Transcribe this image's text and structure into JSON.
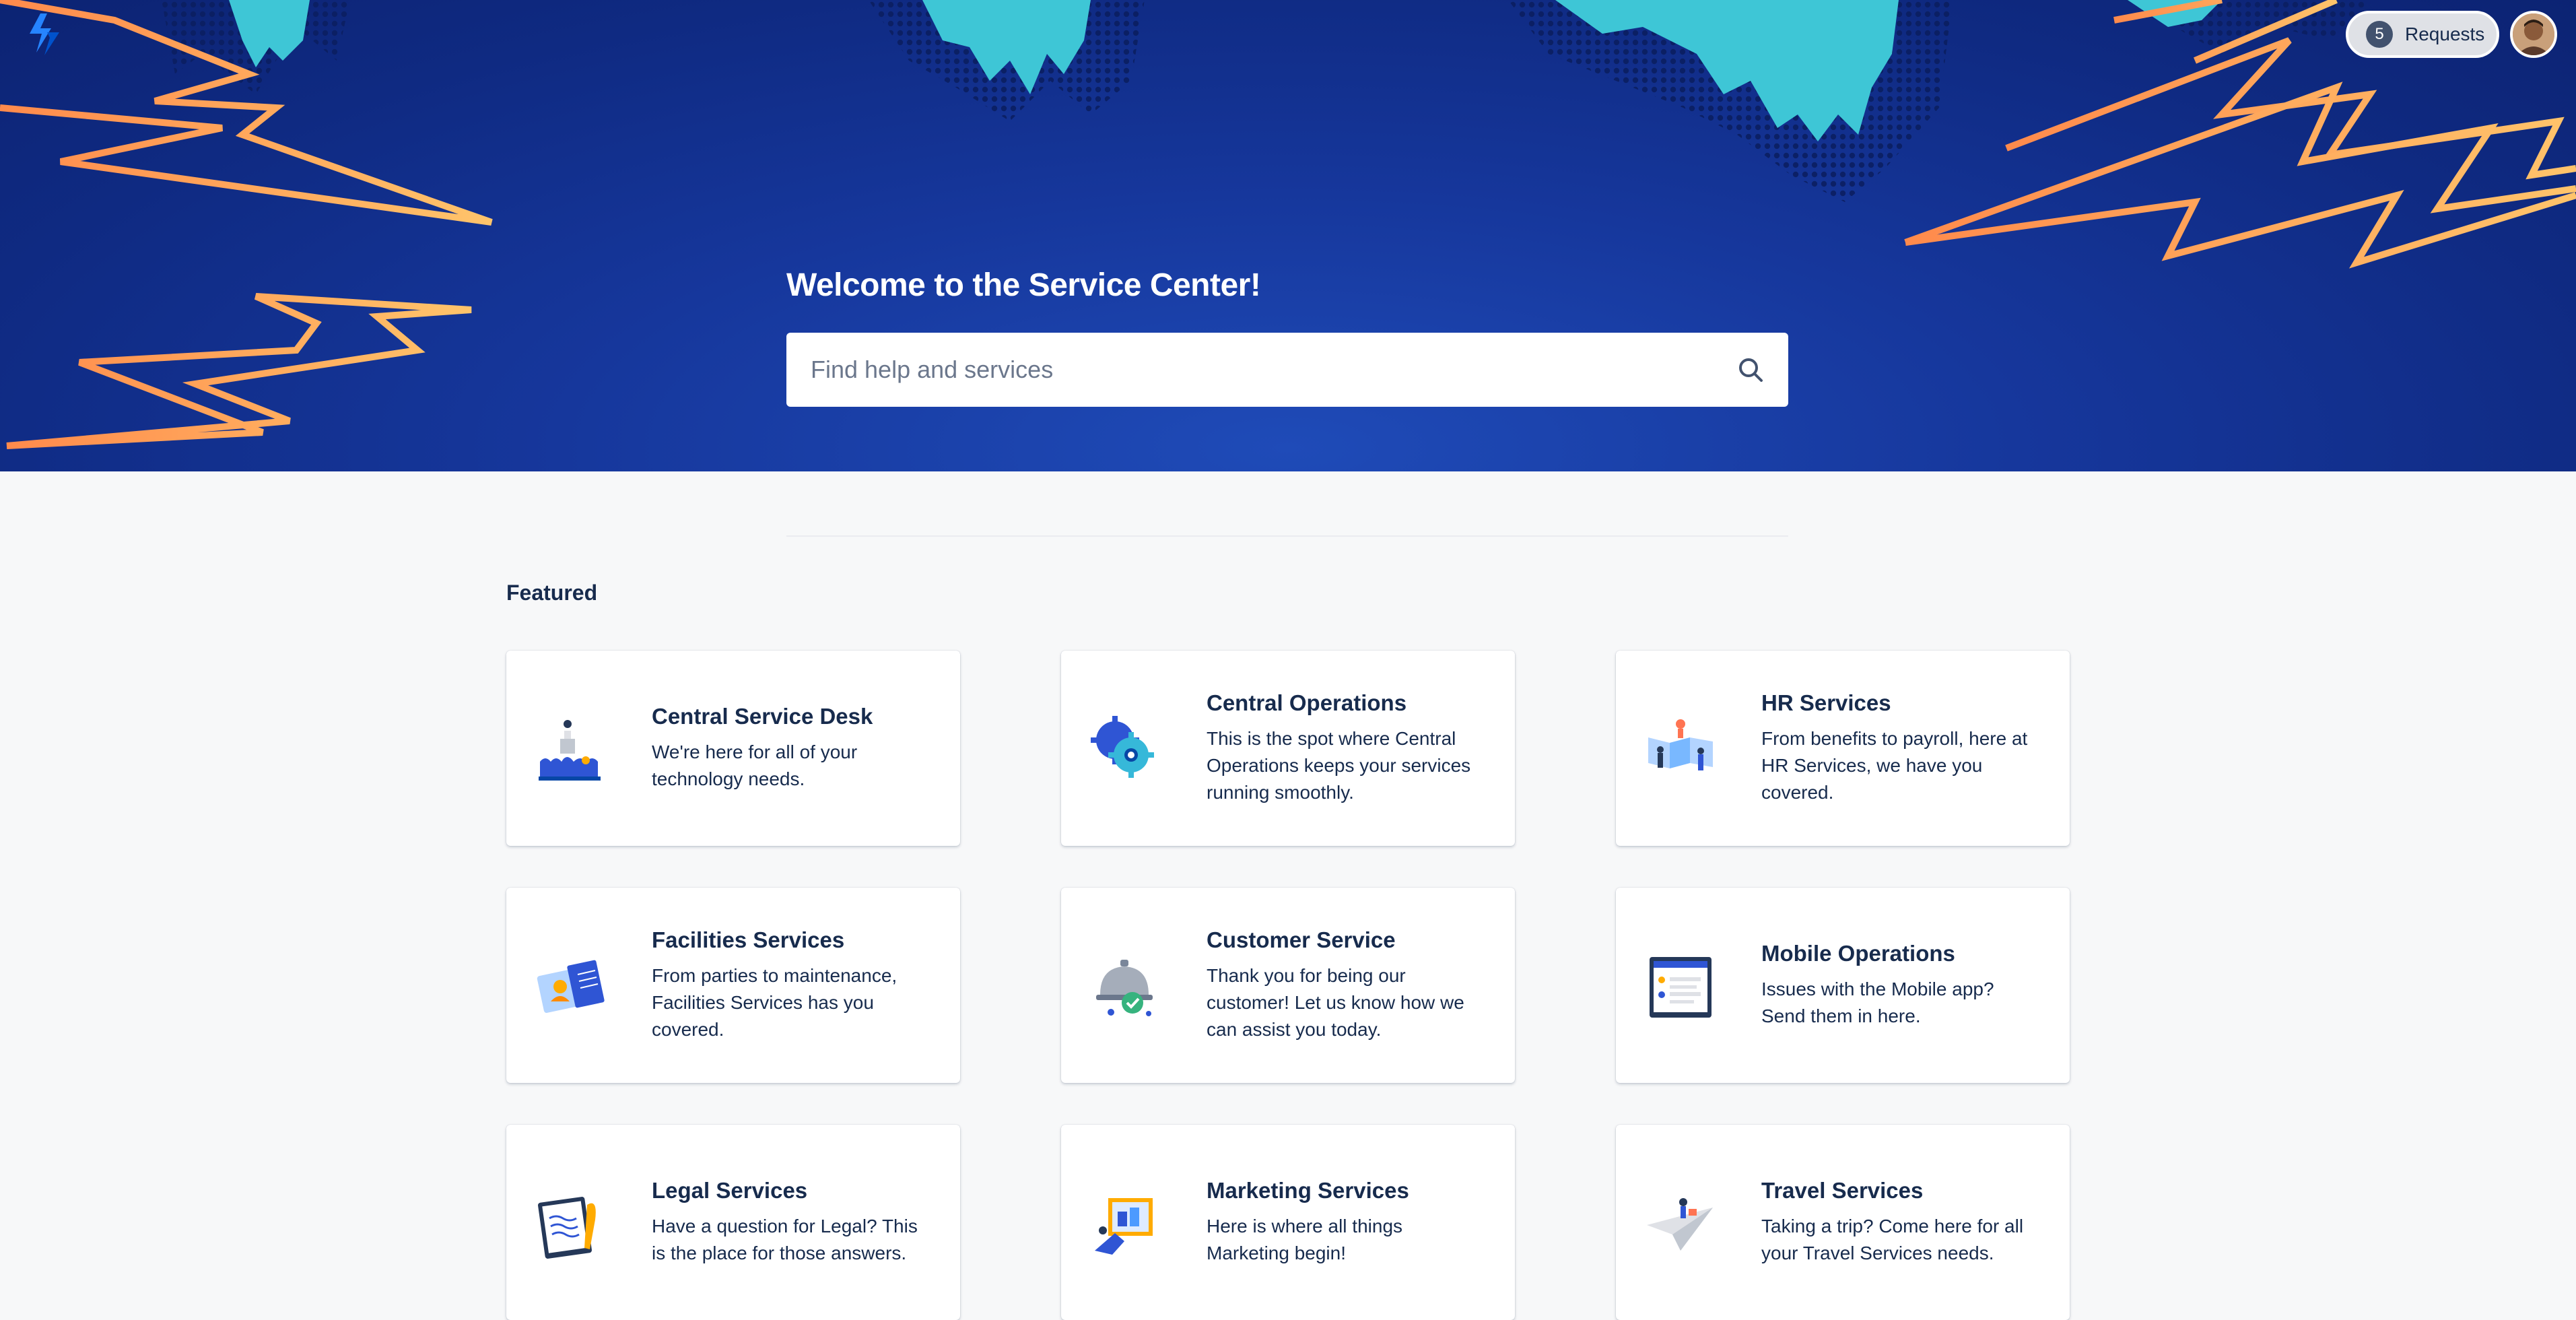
{
  "header": {
    "requests_count": "5",
    "requests_label": "Requests"
  },
  "hero": {
    "title": "Welcome to the Service Center!",
    "search_placeholder": "Find help and services"
  },
  "featured": {
    "heading": "Featured",
    "cards": [
      {
        "title": "Central Service Desk",
        "description": "We're here for all of your technology needs.",
        "icon": "podium-people-icon"
      },
      {
        "title": "Central Operations",
        "description": "This is the spot where Central Operations keeps your services running smoothly.",
        "icon": "gears-icon"
      },
      {
        "title": "HR Services",
        "description": "From benefits to payroll, here at HR Services, we have you covered.",
        "icon": "people-banner-icon"
      },
      {
        "title": "Facilities Services",
        "description": "From parties to maintenance, Facilities Services has you covered.",
        "icon": "id-card-icon"
      },
      {
        "title": "Customer Service",
        "description": "Thank you for being our customer! Let us know how we can assist you today.",
        "icon": "service-bell-icon"
      },
      {
        "title": "Mobile Operations",
        "description": "Issues with the Mobile app? Send them in here.",
        "icon": "mobile-app-icon"
      },
      {
        "title": "Legal Services",
        "description": "Have a question for Legal? This is the place for those answers.",
        "icon": "document-tablet-icon"
      },
      {
        "title": "Marketing Services",
        "description": "Here is where all things Marketing begin!",
        "icon": "marketing-board-icon"
      },
      {
        "title": "Travel Services",
        "description": "Taking a trip? Come here for all your Travel Services needs.",
        "icon": "paper-plane-icon"
      }
    ]
  },
  "colors": {
    "hero_blue": "#16379c",
    "bolt_orange": "#f6964a",
    "cyan_drip": "#3ec6d6",
    "text_dark": "#172b4d",
    "page_bg": "#f7f8f9"
  }
}
